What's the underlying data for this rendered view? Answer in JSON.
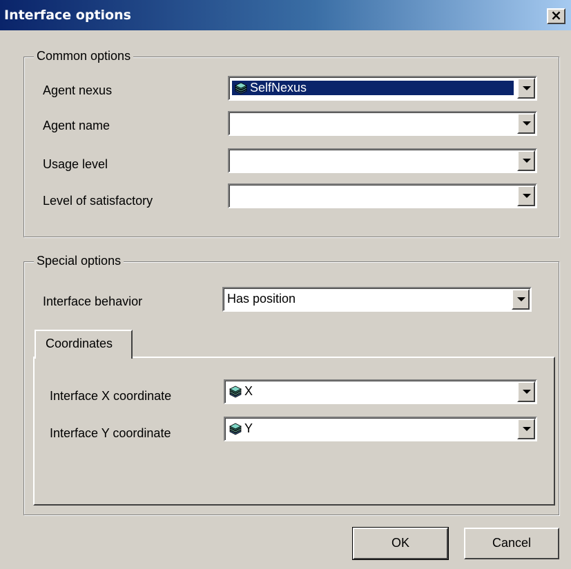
{
  "window": {
    "title": "Interface options",
    "close_label": "×"
  },
  "common": {
    "group_label": "Common options",
    "agent_nexus": {
      "label": "Agent nexus",
      "value": "SelfNexus",
      "icon": "layers-icon"
    },
    "agent_name": {
      "label": "Agent name",
      "value": ""
    },
    "usage_level": {
      "label": "Usage level",
      "value": ""
    },
    "satisfactory": {
      "label": "Level of satisfactory",
      "value": ""
    }
  },
  "special": {
    "group_label": "Special options",
    "behavior": {
      "label": "Interface behavior",
      "value": "Has position"
    },
    "tab_label": "Coordinates",
    "x_coord": {
      "label": "Interface X coordinate",
      "value": "X",
      "icon": "layers-icon"
    },
    "y_coord": {
      "label": "Interface Y coordinate",
      "value": "Y",
      "icon": "layers-icon"
    }
  },
  "buttons": {
    "ok": "OK",
    "cancel": "Cancel"
  },
  "colors": {
    "title_start": "#0a246a",
    "title_end": "#a6caf0",
    "selection": "#0a246a",
    "face": "#d4d0c8"
  }
}
